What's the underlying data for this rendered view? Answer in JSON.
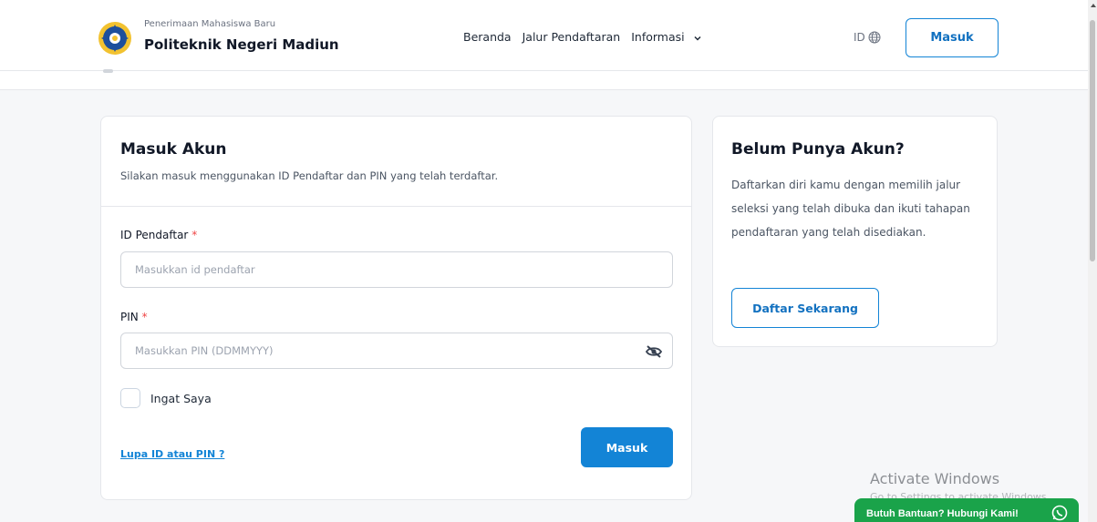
{
  "header": {
    "brand_subtitle": "Penerimaan Mahasiswa Baru",
    "brand_title": "Politeknik Negeri Madiun",
    "nav": [
      {
        "label": "Beranda"
      },
      {
        "label": "Jalur Pendaftaran"
      },
      {
        "label": "Informasi"
      }
    ],
    "lang_label": "ID",
    "login_button": "Masuk"
  },
  "login": {
    "title": "Masuk Akun",
    "description": "Silakan masuk menggunakan ID Pendaftar dan PIN yang telah terdaftar.",
    "id_label": "ID Pendaftar",
    "id_placeholder": "Masukkan id pendaftar",
    "pin_label": "PIN",
    "pin_placeholder": "Masukkan PIN (DDMMYYY)",
    "required_mark": "*",
    "remember_label": "Ingat Saya",
    "forgot_link": "Lupa ID atau PIN ?",
    "submit_button": "Masuk"
  },
  "signup": {
    "title": "Belum Punya Akun?",
    "description": "Daftarkan diri kamu dengan memilih jalur seleksi yang telah dibuka dan ikuti tahapan pendaftaran yang telah disediakan.",
    "button": "Daftar Sekarang"
  },
  "watermark": {
    "title": "Activate Windows",
    "subtitle": "Go to Settings to activate Windows."
  },
  "help": {
    "label": "Butuh Bantuan? Hubungi Kami!"
  },
  "colors": {
    "accent": "#1384d6",
    "whatsapp": "#1aa34a",
    "required": "#ef4444"
  },
  "icons": [
    "logo-icon",
    "chevron-down-icon",
    "globe-icon",
    "eye-off-icon",
    "whatsapp-icon"
  ]
}
